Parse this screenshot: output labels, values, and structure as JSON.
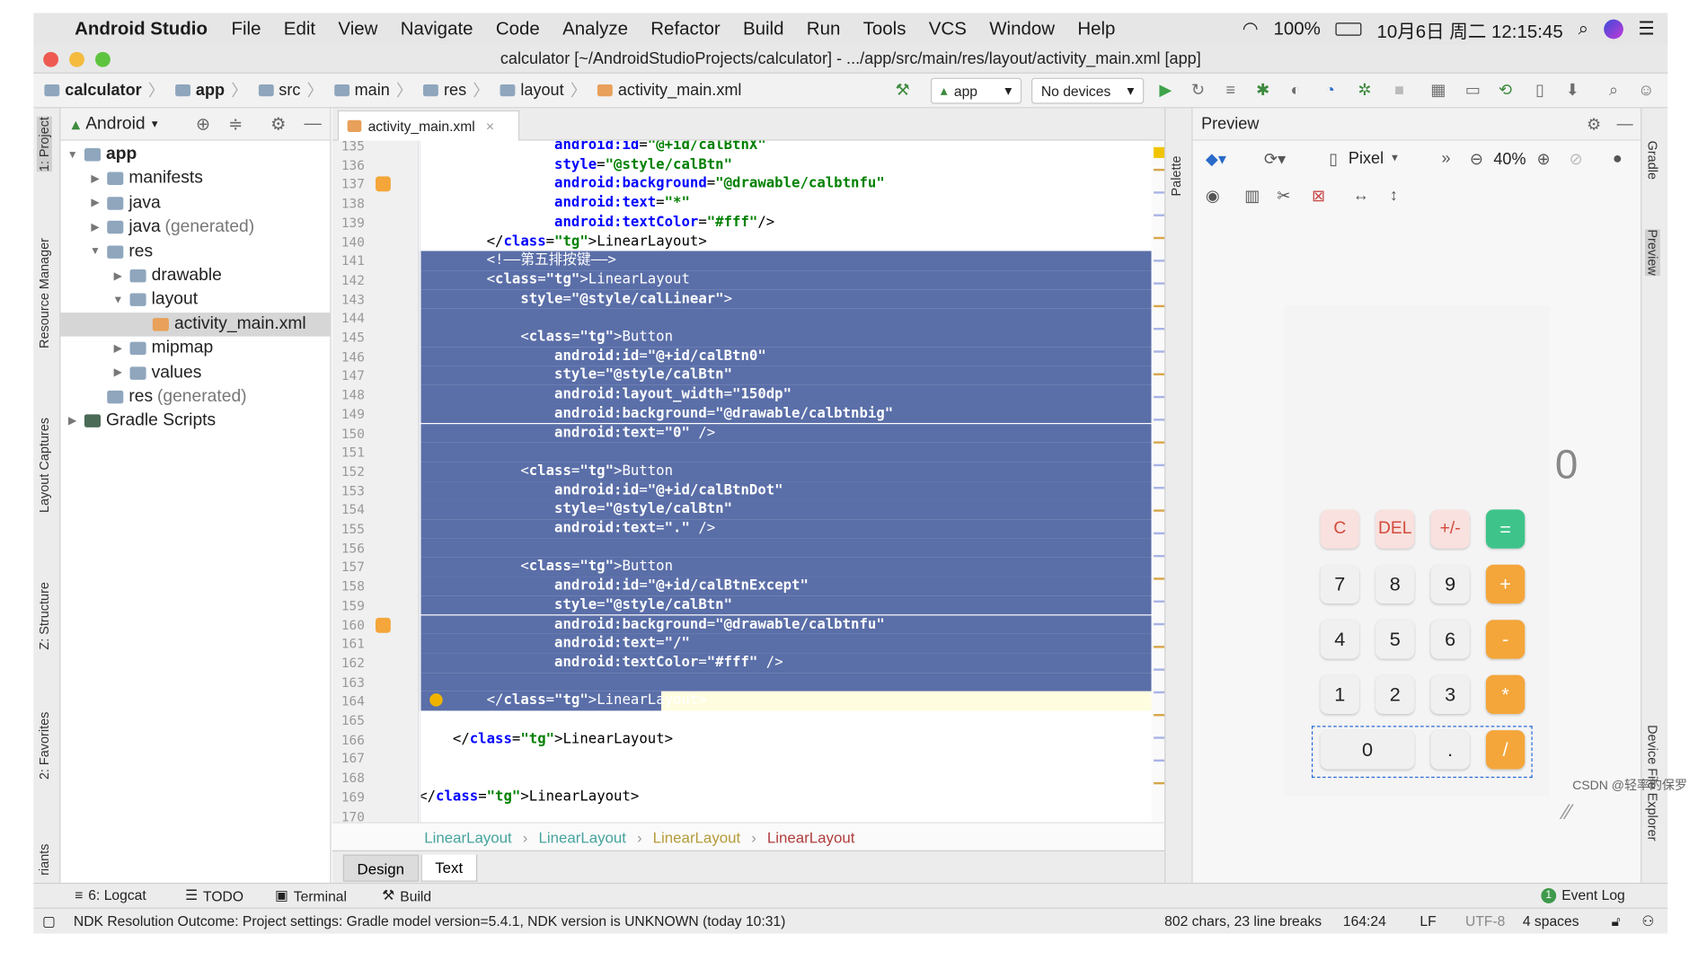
{
  "menubar": {
    "app_name": "Android Studio",
    "items": [
      "File",
      "Edit",
      "View",
      "Navigate",
      "Code",
      "Analyze",
      "Refactor",
      "Build",
      "Run",
      "Tools",
      "VCS",
      "Window",
      "Help"
    ],
    "battery": "100%",
    "datetime": "10月6日 周二 12:15:45"
  },
  "window": {
    "title": "calculator [~/AndroidStudioProjects/calculator] - .../app/src/main/res/layout/activity_main.xml [app]"
  },
  "breadcrumbs": [
    "calculator",
    "app",
    "src",
    "main",
    "res",
    "layout",
    "activity_main.xml"
  ],
  "toolbar": {
    "run_config": "app",
    "device": "No devices"
  },
  "left_tabs": [
    "1: Project",
    "Resource Manager",
    "Layout Captures",
    "Z: Structure",
    "2: Favorites",
    "riants"
  ],
  "project": {
    "view_selector": "Android",
    "tree": [
      {
        "label": "app",
        "depth": 0,
        "expanded": true,
        "bold": true
      },
      {
        "label": "manifests",
        "depth": 1,
        "expanded": false
      },
      {
        "label": "java",
        "depth": 1,
        "expanded": false
      },
      {
        "label": "java",
        "suffix": "(generated)",
        "depth": 1,
        "expanded": false
      },
      {
        "label": "res",
        "depth": 1,
        "expanded": true
      },
      {
        "label": "drawable",
        "depth": 2,
        "expanded": false
      },
      {
        "label": "layout",
        "depth": 2,
        "expanded": true
      },
      {
        "label": "activity_main.xml",
        "depth": 3,
        "selected": true,
        "file": true
      },
      {
        "label": "mipmap",
        "depth": 2,
        "expanded": false
      },
      {
        "label": "values",
        "depth": 2,
        "expanded": false
      },
      {
        "label": "res",
        "suffix": "(generated)",
        "depth": 1,
        "leaf": true
      },
      {
        "label": "Gradle Scripts",
        "depth": 0,
        "expanded": false
      }
    ]
  },
  "editor": {
    "tab_label": "activity_main.xml",
    "first_line": 135,
    "lines": [
      {
        "n": 135,
        "text": "                android:id=\"@+id/calBtnX\""
      },
      {
        "n": 136,
        "text": "                style=\"@style/calBtn\""
      },
      {
        "n": 137,
        "text": "                android:background=\"@drawable/calbtnfu\""
      },
      {
        "n": 138,
        "text": "                android:text=\"*\""
      },
      {
        "n": 139,
        "text": "                android:textColor=\"#fff\"/>"
      },
      {
        "n": 140,
        "text": "        </LinearLayout>"
      },
      {
        "n": 141,
        "text": "        <!——第五排按键——>",
        "sel": true
      },
      {
        "n": 142,
        "text": "        <LinearLayout",
        "sel": true
      },
      {
        "n": 143,
        "text": "            style=\"@style/calLinear\">",
        "sel": true
      },
      {
        "n": 144,
        "text": "",
        "sel": true
      },
      {
        "n": 145,
        "text": "            <Button",
        "sel": true
      },
      {
        "n": 146,
        "text": "                android:id=\"@+id/calBtn0\"",
        "sel": true
      },
      {
        "n": 147,
        "text": "                style=\"@style/calBtn\"",
        "sel": true
      },
      {
        "n": 148,
        "text": "                android:layout_width=\"150dp\"",
        "sel": true
      },
      {
        "n": 149,
        "text": "                android:background=\"@drawable/calbtnbig\"",
        "sel": true
      },
      {
        "n": 150,
        "text": "                android:text=\"0\" />",
        "sel": true
      },
      {
        "n": 151,
        "text": "",
        "sel": true
      },
      {
        "n": 152,
        "text": "            <Button",
        "sel": true
      },
      {
        "n": 153,
        "text": "                android:id=\"@+id/calBtnDot\"",
        "sel": true
      },
      {
        "n": 154,
        "text": "                style=\"@style/calBtn\"",
        "sel": true
      },
      {
        "n": 155,
        "text": "                android:text=\".\" />",
        "sel": true
      },
      {
        "n": 156,
        "text": "",
        "sel": true
      },
      {
        "n": 157,
        "text": "            <Button",
        "sel": true
      },
      {
        "n": 158,
        "text": "                android:id=\"@+id/calBtnExcept\"",
        "sel": true
      },
      {
        "n": 159,
        "text": "                style=\"@style/calBtn\"",
        "sel": true
      },
      {
        "n": 160,
        "text": "                android:background=\"@drawable/calbtnfu\"",
        "sel": true
      },
      {
        "n": 161,
        "text": "                android:text=\"/\"",
        "sel": true
      },
      {
        "n": 162,
        "text": "                android:textColor=\"#fff\" />",
        "sel": true
      },
      {
        "n": 163,
        "text": "",
        "sel": true
      },
      {
        "n": 164,
        "text": "        </LinearLayout>",
        "sel": true,
        "cur": true
      },
      {
        "n": 165,
        "text": ""
      },
      {
        "n": 166,
        "text": "    </LinearLayout>"
      },
      {
        "n": 167,
        "text": ""
      },
      {
        "n": 168,
        "text": ""
      },
      {
        "n": 169,
        "text": "</LinearLayout>"
      },
      {
        "n": 170,
        "text": ""
      }
    ],
    "breadcrumb": [
      "LinearLayout",
      "LinearLayout",
      "LinearLayout",
      "LinearLayout"
    ],
    "bottom_tabs": [
      "Design",
      "Text"
    ],
    "active_bottom_tab": "Text"
  },
  "palette_tab": "Palette",
  "preview": {
    "title": "Preview",
    "device": "Pixel",
    "zoom": "40%",
    "display": "0",
    "keys": [
      [
        "C",
        "DEL",
        "+/-",
        "="
      ],
      [
        "7",
        "8",
        "9",
        "+"
      ],
      [
        "4",
        "5",
        "6",
        "-"
      ],
      [
        "1",
        "2",
        "3",
        "*"
      ],
      [
        "0",
        ".",
        "/"
      ]
    ]
  },
  "right_tabs": [
    "Gradle",
    "Preview",
    "Device File Explorer"
  ],
  "bottom_tools": [
    "6: Logcat",
    "TODO",
    "Terminal",
    "Build",
    "Event Log"
  ],
  "status": {
    "message": "NDK Resolution Outcome: Project settings: Gradle model version=5.4.1, NDK version is UNKNOWN (today 10:31)",
    "chars": "802 chars, 23 line breaks",
    "position": "164:24",
    "line_sep": "LF",
    "encoding": "UTF-8",
    "indent": "4 spaces"
  },
  "watermark": "CSDN @轻率的保罗",
  "colors": {
    "selection": "#5a6ea8",
    "tag": "#000080",
    "attr": "#0000ff",
    "value": "#008000",
    "orange": "#f4a63a",
    "green": "#3ec48a",
    "red_key": "#d24a3c"
  }
}
